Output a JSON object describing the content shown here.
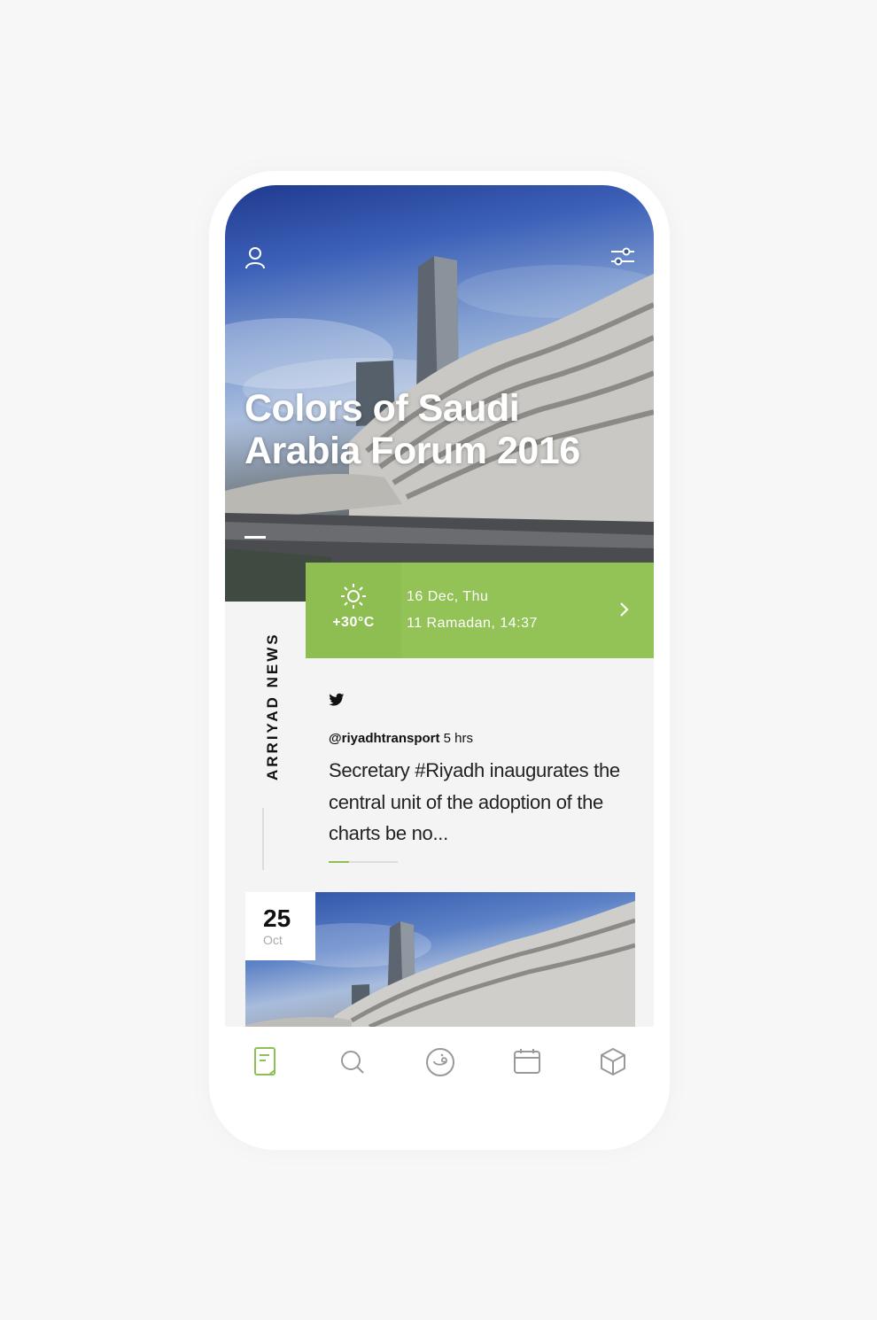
{
  "header": {
    "title": "Colors of Saudi Arabia Forum 2016",
    "profile_icon": "user-icon",
    "filter_icon": "sliders-icon"
  },
  "info_bar": {
    "weather_icon": "sun-icon",
    "temperature": "+30°C",
    "date_line": "16 Dec, Thu",
    "hijri_line": "11 Ramadan, 14:37",
    "arrow_icon": "chevron-right-icon",
    "color": "#93c257"
  },
  "news": {
    "section_label": "ARRIYAD NEWS",
    "source_icon": "twitter-icon",
    "handle": "@riyadhtransport",
    "time": "5 hrs",
    "text": "Secretary #Riyadh inaugurates the central unit of the adoption of the charts be no...",
    "progress": 0.3
  },
  "card": {
    "day": "25",
    "month": "Oct"
  },
  "bottom_nav": {
    "items": [
      {
        "icon": "news-icon",
        "active": true
      },
      {
        "icon": "search-icon",
        "active": false
      },
      {
        "icon": "arabic-letter-icon",
        "active": false
      },
      {
        "icon": "calendar-icon",
        "active": false
      },
      {
        "icon": "cube-icon",
        "active": false
      }
    ],
    "active_color": "#8fc056"
  }
}
